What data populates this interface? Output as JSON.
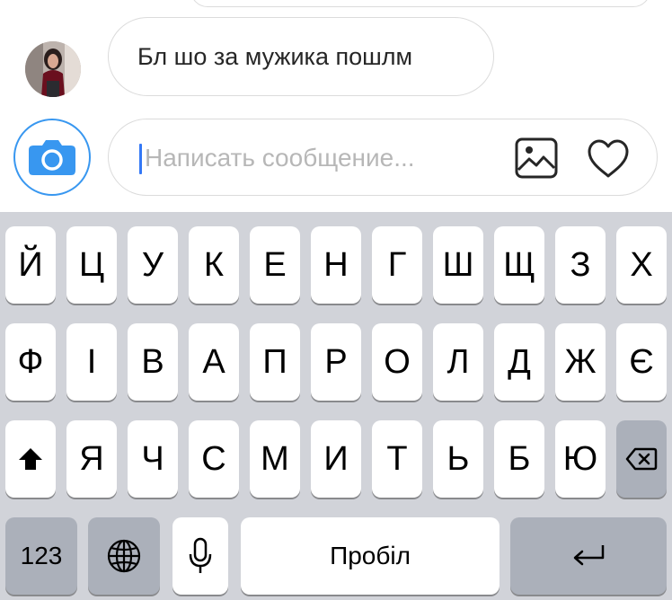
{
  "chat": {
    "last_message": "Бл шо за мужика пошлм"
  },
  "composer": {
    "placeholder": "Написать сообщение..."
  },
  "icons": {
    "camera": "camera-icon",
    "gallery": "gallery-icon",
    "heart": "heart-icon",
    "shift": "shift-icon",
    "backspace": "backspace-icon",
    "globe": "globe-icon",
    "mic": "microphone-icon",
    "return": "return-icon"
  },
  "colors": {
    "accent": "#3897f0",
    "keyboard_bg": "#d1d3d9",
    "key_dark": "#abb0ba"
  },
  "keyboard": {
    "row1": [
      "Й",
      "Ц",
      "У",
      "К",
      "Е",
      "Н",
      "Г",
      "Ш",
      "Щ",
      "З",
      "Х"
    ],
    "row2": [
      "Ф",
      "І",
      "В",
      "А",
      "П",
      "Р",
      "О",
      "Л",
      "Д",
      "Ж",
      "Є"
    ],
    "row3": [
      "Я",
      "Ч",
      "С",
      "М",
      "И",
      "Т",
      "Ь",
      "Б",
      "Ю"
    ],
    "numbers_label": "123",
    "space_label": "Пробіл"
  }
}
